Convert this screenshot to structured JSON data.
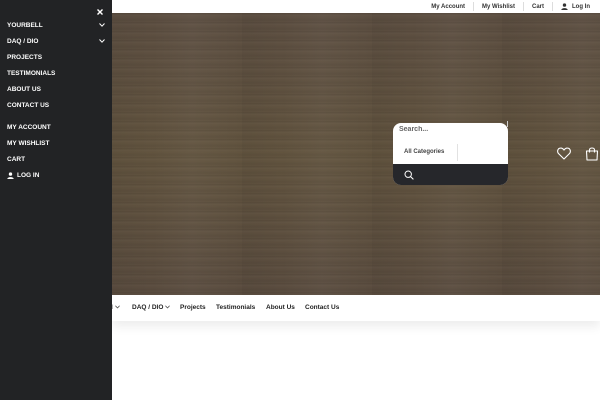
{
  "topbar": {
    "links": [
      "My Account",
      "My Wishlist",
      "Cart"
    ],
    "login": "Log In"
  },
  "search": {
    "placeholder": "Search...",
    "category": "All Categories"
  },
  "header_icons": [
    "heart-icon",
    "shopping-bag-icon"
  ],
  "mainnav": {
    "partial_item": "l",
    "items": [
      "DAQ / DIO",
      "Projects",
      "Testimonials",
      "About Us",
      "Contact Us"
    ]
  },
  "sidebar": {
    "items": [
      "YOURBELL",
      "DAQ / DIO",
      "PROJECTS",
      "TESTIMONIALS",
      "ABOUT US",
      "CONTACT US"
    ],
    "account_items": [
      "MY ACCOUNT",
      "MY WISHLIST",
      "CART"
    ],
    "login": "LOG IN"
  },
  "colors": {
    "sidebar_bg": "#222325",
    "wood": "#5f5143",
    "search_button": "#26272b"
  }
}
